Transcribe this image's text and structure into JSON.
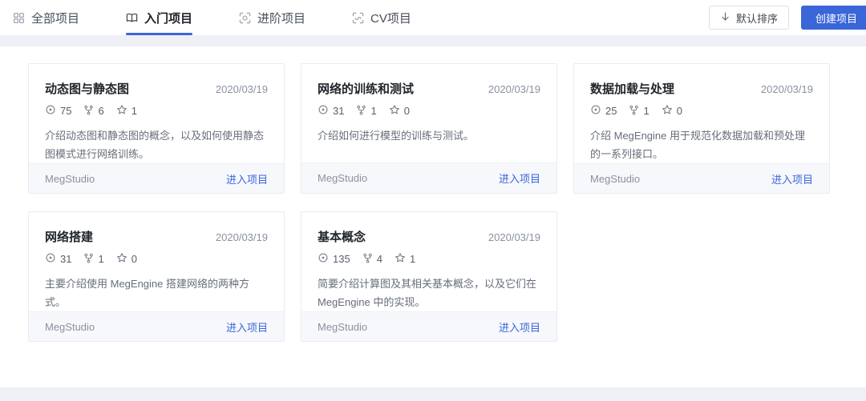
{
  "colors": {
    "accent": "#3a66d9",
    "page_background": "#eef0f5",
    "card_footer_background": "#f7f8fc"
  },
  "header": {
    "tabs": [
      {
        "label": "全部项目",
        "active": false
      },
      {
        "label": "入门项目",
        "active": true
      },
      {
        "label": "进阶项目",
        "active": false
      },
      {
        "label": "CV项目",
        "active": false
      }
    ],
    "sort_button_label": "默认排序",
    "create_button_label": "创建项目"
  },
  "cards": [
    {
      "title": "动态图与静态图",
      "date": "2020/03/19",
      "views": "75",
      "forks": "6",
      "stars": "1",
      "description": "介绍动态图和静态图的概念，以及如何使用静态图模式进行网络训练。",
      "owner": "MegStudio",
      "enter_label": "进入项目"
    },
    {
      "title": "网络的训练和测试",
      "date": "2020/03/19",
      "views": "31",
      "forks": "1",
      "stars": "0",
      "description": "介绍如何进行模型的训练与测试。",
      "owner": "MegStudio",
      "enter_label": "进入项目"
    },
    {
      "title": "数据加载与处理",
      "date": "2020/03/19",
      "views": "25",
      "forks": "1",
      "stars": "0",
      "description": "介绍 MegEngine 用于规范化数据加载和预处理的一系列接口。",
      "owner": "MegStudio",
      "enter_label": "进入项目"
    },
    {
      "title": "网络搭建",
      "date": "2020/03/19",
      "views": "31",
      "forks": "1",
      "stars": "0",
      "description": "主要介绍使用 MegEngine 搭建网络的两种方式。",
      "owner": "MegStudio",
      "enter_label": "进入项目"
    },
    {
      "title": "基本概念",
      "date": "2020/03/19",
      "views": "135",
      "forks": "4",
      "stars": "1",
      "description": "简要介绍计算图及其相关基本概念，以及它们在 MegEngine 中的实现。",
      "owner": "MegStudio",
      "enter_label": "进入项目"
    }
  ]
}
